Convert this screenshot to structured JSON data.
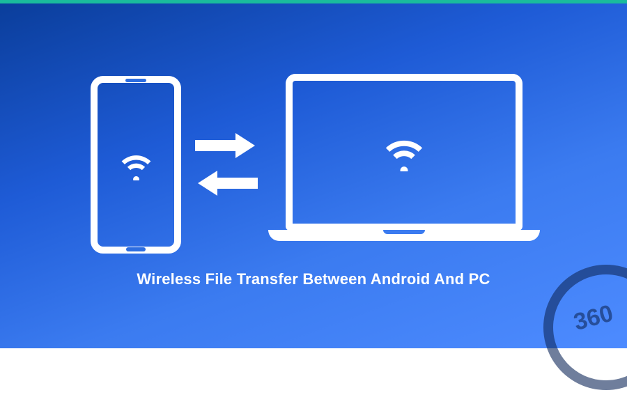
{
  "caption": "Wireless File Transfer Between Android And PC",
  "icons": {
    "phone_wifi": "wifi",
    "laptop_wifi": "wifi"
  },
  "colors": {
    "gradient_start": "#0a3d9a",
    "gradient_end": "#4d8bff",
    "accent_bar": "#1abc9c",
    "foreground": "#ffffff"
  },
  "watermark": "360"
}
